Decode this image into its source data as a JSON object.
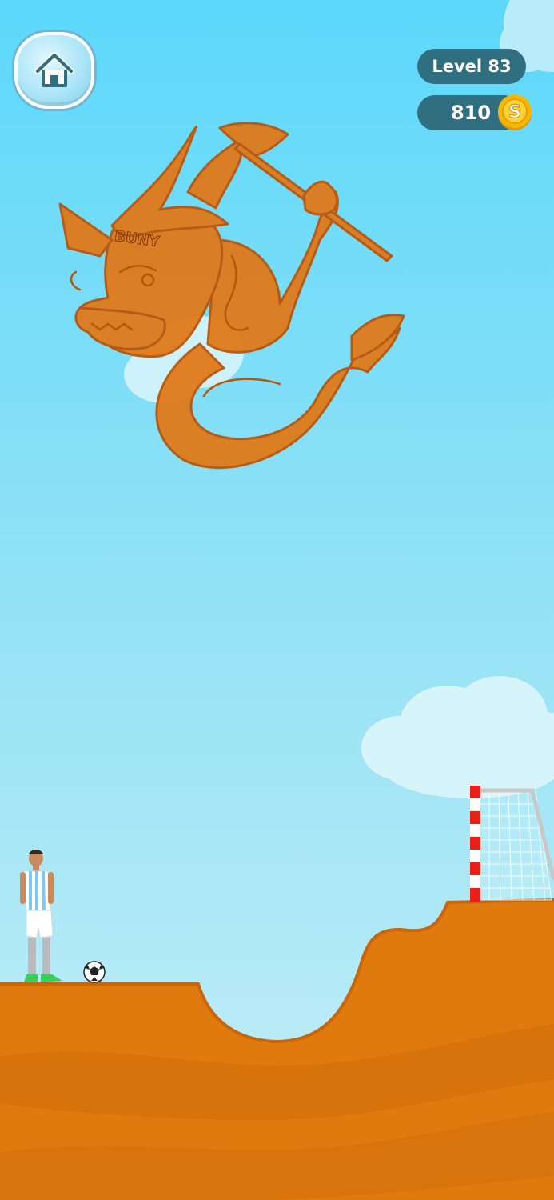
{
  "hud": {
    "level_label": "Level 83",
    "coins": "810",
    "coin_symbol": "S"
  },
  "dragon": {
    "hat_text": "BUNY"
  },
  "colors": {
    "sky_top": "#5cd8fb",
    "ground": "#e07a0e",
    "drawing_fill": "#e07a1a",
    "hud_pill": "#2f6f80",
    "goal_post_red": "#e8201a",
    "coin_gold": "#f5b800"
  },
  "icons": {
    "home": "home-icon",
    "coin": "coin-icon"
  }
}
